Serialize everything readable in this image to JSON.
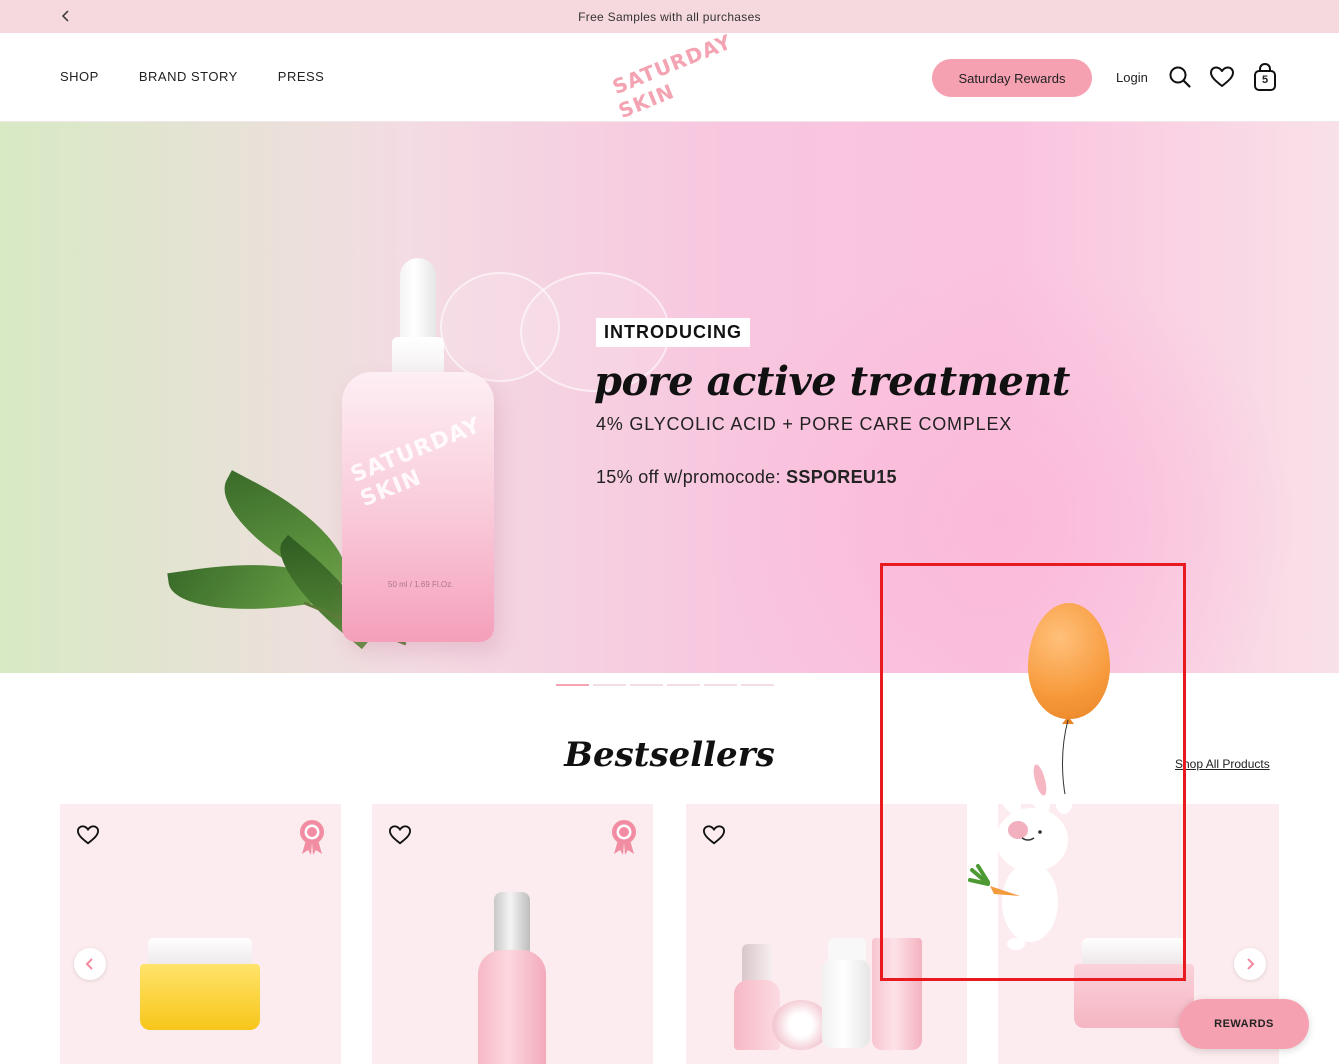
{
  "announcement": {
    "text": "Free Samples with all purchases"
  },
  "header": {
    "nav": [
      "SHOP",
      "BRAND STORY",
      "PRESS"
    ],
    "logo_line1": "SATURDAY",
    "logo_line2": "SKIN",
    "rewards_label": "Saturday Rewards",
    "login_label": "Login",
    "cart_count": "5"
  },
  "hero": {
    "badge": "INTRODUCING",
    "title": "pore active treatment",
    "subtitle": "4% GLYCOLIC ACID + PORE CARE COMPLEX",
    "promo_prefix": "15% off w/promocode: ",
    "promo_code": "SSPOREU15",
    "bottle_brand_1": "SATURDAY",
    "bottle_brand_2": "SKIN",
    "bottle_volume": "50 ml / 1.69 Fl.Oz.",
    "slide_count": 6,
    "active_slide": 1
  },
  "bestsellers": {
    "title": "Bestsellers",
    "shop_all": "Shop All Products"
  },
  "floating": {
    "rewards_label": "REWARDS"
  },
  "colors": {
    "accent_pink": "#f6a1b1",
    "announcement_bg": "#f6d9de",
    "card_bg": "#fcecef",
    "highlight_red": "#e8191f"
  }
}
